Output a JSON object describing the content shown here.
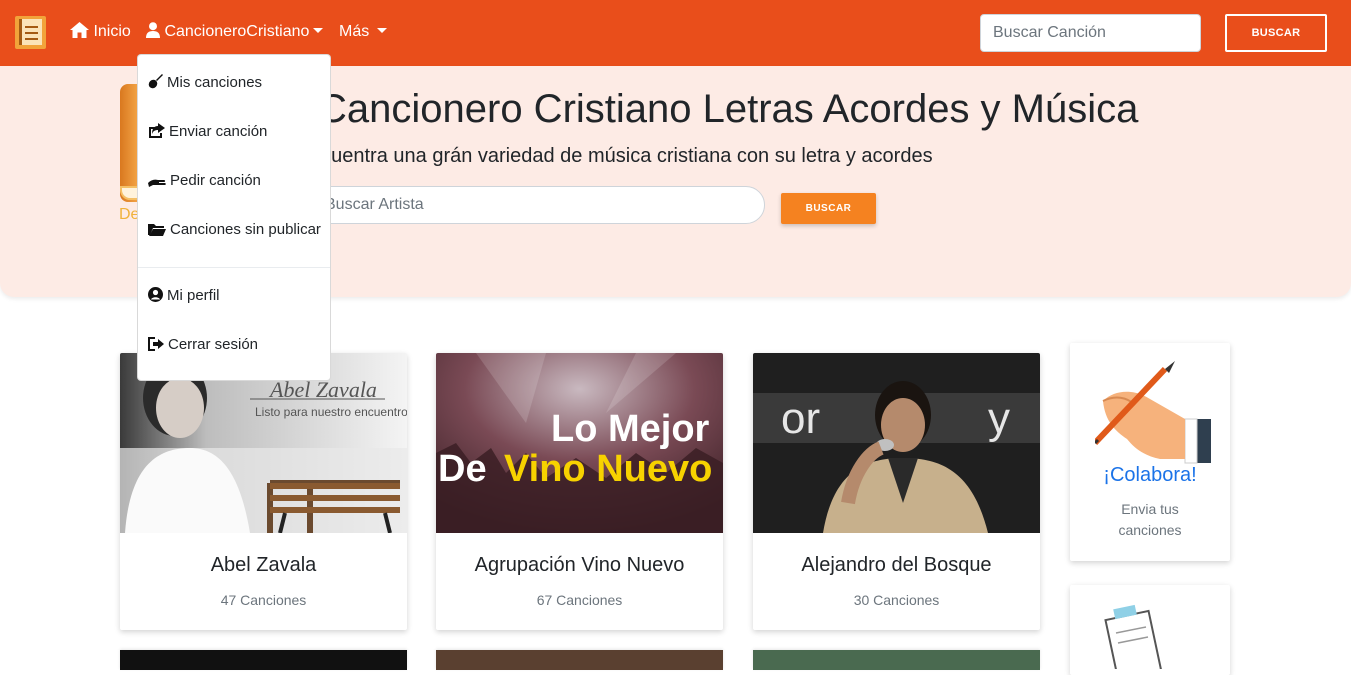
{
  "navbar": {
    "brand_icon": "songbook-logo",
    "links": [
      {
        "label": "Inicio",
        "icon": "home-icon"
      },
      {
        "label": "CancioneroCristiano",
        "icon": "user-icon"
      },
      {
        "label": "Más"
      }
    ],
    "search_placeholder": "Buscar Canción",
    "search_button": "BUSCAR",
    "color": "#e94e1b"
  },
  "dropdown": {
    "items": [
      {
        "label": "Mis canciones",
        "icon": "guitar-icon"
      },
      {
        "label": "Enviar canción",
        "icon": "share-icon"
      },
      {
        "label": "Pedir canción",
        "icon": "hand-icon"
      },
      {
        "label": "Canciones sin publicar",
        "icon": "folder-open-icon"
      },
      {
        "label": "Mi perfil",
        "icon": "user-circle-icon"
      },
      {
        "label": "Cerrar sesión",
        "icon": "sign-out-icon"
      }
    ]
  },
  "hero": {
    "partial_text": "De",
    "title": "Cancionero Cristiano Letras Acordes y Música",
    "subtitle": "ncuentra una grán variedad de música cristiana con su letra y acordes",
    "search_placeholder": "Buscar Artista",
    "search_button": "BUSCAR",
    "background": "#fdebe5",
    "button_color": "#f58220"
  },
  "artists": [
    {
      "name": "Abel Zavala",
      "count": "47 Canciones",
      "image_text": [
        "Abel Zavala",
        "Listo para nuestro encuentro"
      ]
    },
    {
      "name": "Agrupación Vino Nuevo",
      "count": "67 Canciones",
      "image_text": [
        "Lo Mejor",
        "De",
        "Vino Nuevo"
      ]
    },
    {
      "name": "Alejandro del Bosque",
      "count": "30 Canciones",
      "image_text": [
        "or",
        "y"
      ]
    }
  ],
  "side": {
    "colabora_title": "¡Colabora!",
    "colabora_text": "Envia tus canciones"
  }
}
